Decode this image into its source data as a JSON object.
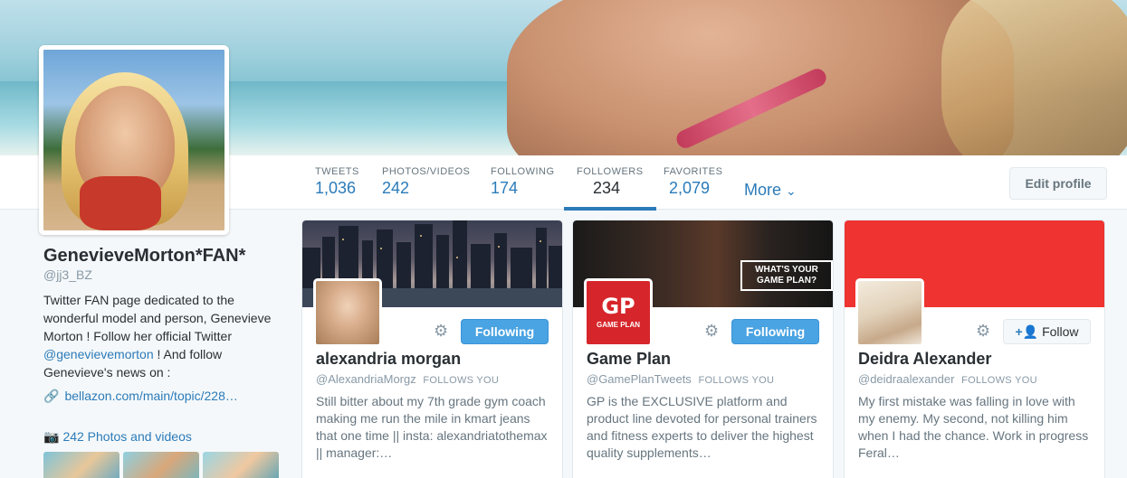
{
  "nav": {
    "stats": [
      {
        "label": "TWEETS",
        "value": "1,036"
      },
      {
        "label": "PHOTOS/VIDEOS",
        "value": "242"
      },
      {
        "label": "FOLLOWING",
        "value": "174"
      },
      {
        "label": "FOLLOWERS",
        "value": "234"
      },
      {
        "label": "FAVORITES",
        "value": "2,079"
      }
    ],
    "more_label": "More",
    "more_chevron": "⌄",
    "edit_profile_label": "Edit profile"
  },
  "profile": {
    "name": "GenevieveMorton*FAN*",
    "handle": "@jj3_BZ",
    "bio_part1": "Twitter FAN page dedicated to the wonderful model and person, Genevieve Morton ! Follow her official Twitter ",
    "bio_link": "@genevievemorton",
    "bio_part2": " ! And follow Genevieve's news on :",
    "url": "bellazon.com/main/topic/228…",
    "photos_label": "242 Photos and videos"
  },
  "cards": [
    {
      "name": "alexandria morgan",
      "handle": "@AlexandriaMorgz",
      "follows_you": "FOLLOWS YOU",
      "button": "Following",
      "bio": "Still bitter about my 7th grade gym coach making me run the mile in kmart jeans that one time || insta: alexandriatothemax || manager:…"
    },
    {
      "name": "Game Plan",
      "handle": "@GamePlanTweets",
      "follows_you": "FOLLOWS YOU",
      "button": "Following",
      "bio": "GP is the EXCLUSIVE platform and product line devoted for personal trainers and fitness experts to deliver the highest quality supplements…",
      "cover_badge": "WHAT'S YOUR GAME PLAN?",
      "logo_text": "GP",
      "logo_sub": "GAME PLAN"
    },
    {
      "name": "Deidra Alexander",
      "handle": "@deidraalexander",
      "follows_you": "FOLLOWS YOU",
      "button": "Follow",
      "bio": "My first mistake was falling in love with my enemy. My second, not killing him when I had the chance. Work in progress Feral…"
    }
  ],
  "colors": {
    "accent": "#2b7bb9",
    "following_button": "#4aa3e2",
    "deidra_cover": "#ee3330"
  },
  "icons": {
    "settings": "gear-icon",
    "link": "link-icon",
    "camera": "camera-icon",
    "add_user": "add-user-icon"
  }
}
